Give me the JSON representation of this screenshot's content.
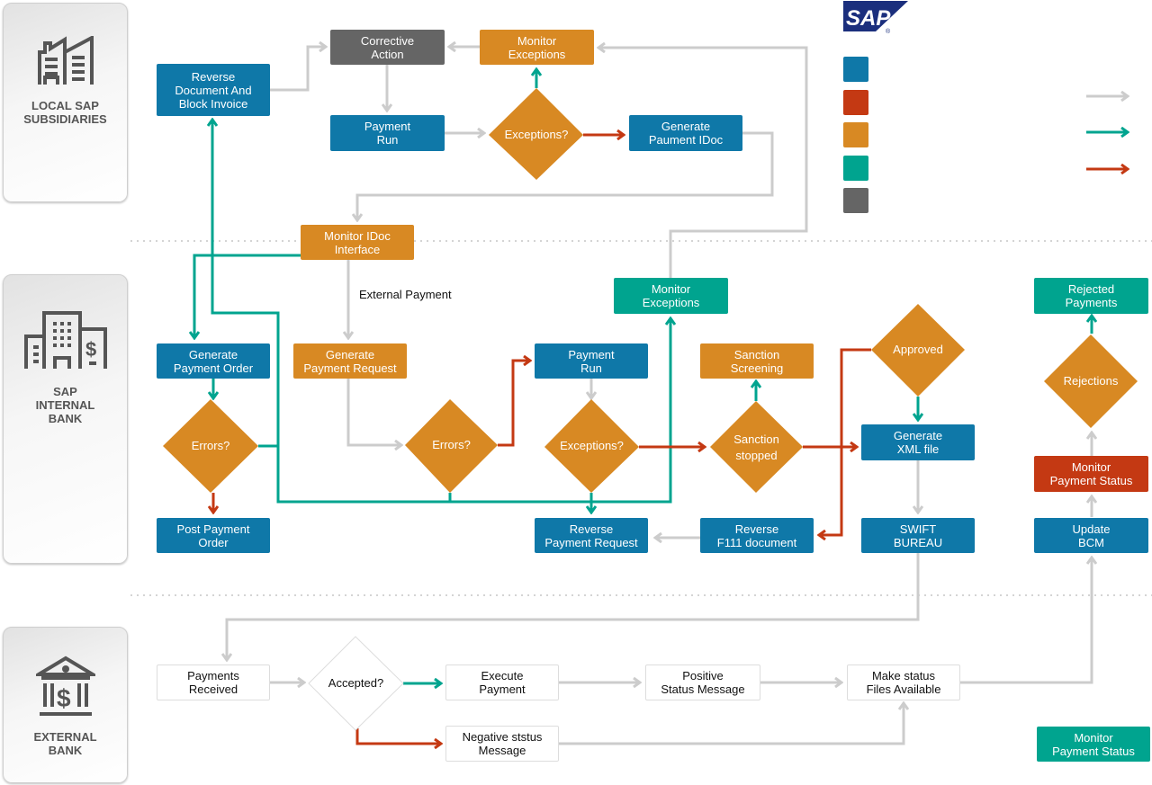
{
  "brand": {
    "logo_text": "SAP",
    "logo_mark": "®"
  },
  "lanes": [
    {
      "id": "local",
      "label": "LOCAL SAP\nSUBSIDIARIES",
      "icon": "factory-icon"
    },
    {
      "id": "internal",
      "label": "SAP\nINTERNAL\nBANK",
      "icon": "buildings-dollar-icon"
    },
    {
      "id": "external",
      "label": "EXTERNAL\nBANK",
      "icon": "bank-dollar-icon"
    }
  ],
  "colors": {
    "blue": "#0f78a8",
    "red": "#c43913",
    "orange": "#d88923",
    "teal": "#00a48f",
    "gray": "#656565",
    "line_gray": "#cccccc",
    "line_teal": "#00a48f",
    "line_red": "#c43913"
  },
  "legend": {
    "swatches": [
      {
        "color": "#0f78a8",
        "label": ""
      },
      {
        "color": "#c43913",
        "label": ""
      },
      {
        "color": "#d88923",
        "label": ""
      },
      {
        "color": "#00a48f",
        "label": ""
      },
      {
        "color": "#656565",
        "label": ""
      }
    ],
    "arrows": [
      {
        "color": "#cccccc",
        "label": ""
      },
      {
        "color": "#00a48f",
        "label": ""
      },
      {
        "color": "#c43913",
        "label": ""
      }
    ]
  },
  "nodes": {
    "reverse_doc": "Reverse\nDocument And\nBlock Invoice",
    "corrective_action": "Corrective\nAction",
    "monitor_exceptions_top": "Monitor\nExceptions",
    "payment_run_top": "Payment\nRun",
    "exceptions_top": "Exceptions?",
    "generate_idoc": "Generate\nPaument IDoc",
    "monitor_idoc": "Monitor IDoc\nInterface",
    "external_payment": "External Payment",
    "monitor_exceptions_mid": "Monitor\nExceptions",
    "generate_payment_order": "Generate\nPayment Order",
    "errors_left": "Errors?",
    "post_payment_order": "Post Payment\nOrder",
    "generate_payment_request": "Generate\nPayment Request",
    "errors_mid": "Errors?",
    "payment_run_mid": "Payment\nRun",
    "exceptions_mid": "Exceptions?",
    "reverse_payment_request": "Reverse\nPayment Request",
    "sanction_screening": "Sanction\nScreening",
    "sanction_stopped": "Sanction\nstopped",
    "reverse_f111": "Reverse\nF111 document",
    "approved": "Approved",
    "generate_xml": "Generate\nXML file",
    "swift_bureau": "SWIFT\nBUREAU",
    "rejected_payments": "Rejected\nPayments",
    "rejections": "Rejections",
    "monitor_payment_status_red": "Monitor\nPayment Status",
    "update_bcm": "Update\nBCM",
    "payments_received": "Payments\nReceived",
    "accepted": "Accepted?",
    "execute_payment": "Execute\nPayment",
    "positive_status": "Positive\nStatus Message",
    "make_status_files": "Make status\nFiles Available",
    "negative_status": "Negative ststus\nMessage",
    "monitor_payment_status_teal": "Monitor\nPayment Status"
  }
}
